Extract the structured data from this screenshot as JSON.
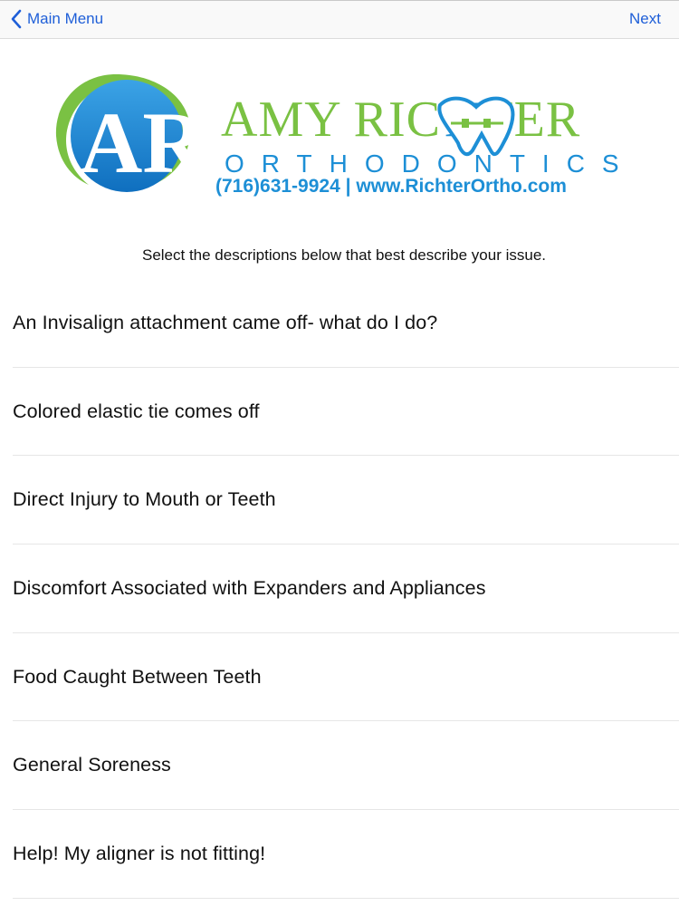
{
  "nav": {
    "back_label": "Main Menu",
    "next_label": "Next",
    "accent_color": "#1f5fd8"
  },
  "logo": {
    "monogram": "AR",
    "name": "AMY RICHTER",
    "name_part1": "AMY RIC",
    "name_part2": "TER",
    "subtitle": "ORTHODONTICS",
    "contact": "(716)631-9924 | www.RichterOrtho.com",
    "colors": {
      "green": "#7ac143",
      "blue": "#1d8fd6"
    }
  },
  "instruction": "Select the descriptions below that best describe your issue.",
  "issues": [
    {
      "label": "An Invisalign attachment came off- what do I do?"
    },
    {
      "label": "Colored elastic tie comes off"
    },
    {
      "label": "Direct Injury to Mouth or Teeth"
    },
    {
      "label": "Discomfort Associated with Expanders and Appliances"
    },
    {
      "label": "Food Caught Between Teeth"
    },
    {
      "label": "General Soreness"
    },
    {
      "label": "Help! My aligner is not fitting!"
    }
  ]
}
